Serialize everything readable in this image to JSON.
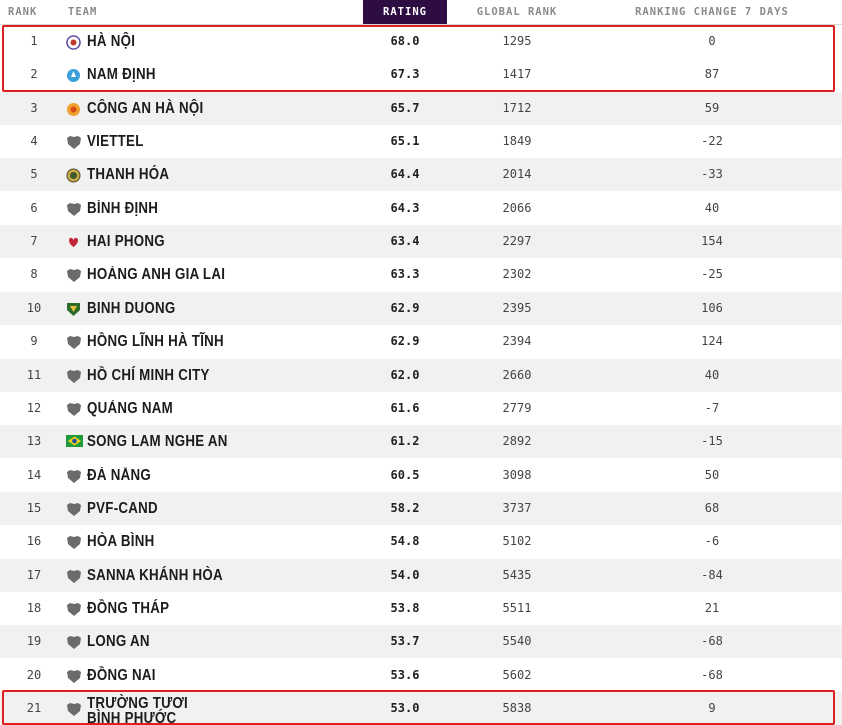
{
  "headers": {
    "rank": "RANK",
    "team": "TEAM",
    "rating": "RATING",
    "global_rank": "GLOBAL RANK",
    "change": "RANKING CHANGE 7 DAYS"
  },
  "rows": [
    {
      "rank": "1",
      "team": "HÀ NỘI",
      "rating": "68.0",
      "global": "1295",
      "change": "0",
      "icon": "hanoi-crest-icon"
    },
    {
      "rank": "2",
      "team": "NAM ĐỊNH",
      "rating": "67.3",
      "global": "1417",
      "change": "87",
      "icon": "namdinh-crest-icon"
    },
    {
      "rank": "3",
      "team": "CÔNG AN HÀ NỘI",
      "rating": "65.7",
      "global": "1712",
      "change": "59",
      "icon": "conganhanoi-crest-icon"
    },
    {
      "rank": "4",
      "team": "VIETTEL",
      "rating": "65.1",
      "global": "1849",
      "change": "-22",
      "icon": "shield-placeholder-icon"
    },
    {
      "rank": "5",
      "team": "THANH HÓA",
      "rating": "64.4",
      "global": "2014",
      "change": "-33",
      "icon": "thanhhoa-crest-icon"
    },
    {
      "rank": "6",
      "team": "BÌNH ĐỊNH",
      "rating": "64.3",
      "global": "2066",
      "change": "40",
      "icon": "shield-placeholder-icon"
    },
    {
      "rank": "7",
      "team": "HAI PHONG",
      "rating": "63.4",
      "global": "2297",
      "change": "154",
      "icon": "haiphong-crest-icon"
    },
    {
      "rank": "8",
      "team": "HOÀNG ANH GIA LAI",
      "rating": "63.3",
      "global": "2302",
      "change": "-25",
      "icon": "shield-placeholder-icon"
    },
    {
      "rank": "10",
      "team": "BINH DUONG",
      "rating": "62.9",
      "global": "2395",
      "change": "106",
      "icon": "binhduong-crest-icon"
    },
    {
      "rank": "9",
      "team": "HỒNG LĨNH HÀ TĨNH",
      "rating": "62.9",
      "global": "2394",
      "change": "124",
      "icon": "shield-placeholder-icon"
    },
    {
      "rank": "11",
      "team": "HỒ CHÍ MINH CITY",
      "rating": "62.0",
      "global": "2660",
      "change": "40",
      "icon": "shield-placeholder-icon"
    },
    {
      "rank": "12",
      "team": "QUẢNG NAM",
      "rating": "61.6",
      "global": "2779",
      "change": "-7",
      "icon": "shield-placeholder-icon"
    },
    {
      "rank": "13",
      "team": "SONG LAM NGHE AN",
      "rating": "61.2",
      "global": "2892",
      "change": "-15",
      "icon": "songlam-crest-icon"
    },
    {
      "rank": "14",
      "team": "ĐÀ NẴNG",
      "rating": "60.5",
      "global": "3098",
      "change": "50",
      "icon": "shield-placeholder-icon"
    },
    {
      "rank": "15",
      "team": "PVF-CAND",
      "rating": "58.2",
      "global": "3737",
      "change": "68",
      "icon": "shield-placeholder-icon"
    },
    {
      "rank": "16",
      "team": "HÒA BÌNH",
      "rating": "54.8",
      "global": "5102",
      "change": "-6",
      "icon": "shield-placeholder-icon"
    },
    {
      "rank": "17",
      "team": "SANNA KHÁNH HÒA",
      "rating": "54.0",
      "global": "5435",
      "change": "-84",
      "icon": "shield-placeholder-icon"
    },
    {
      "rank": "18",
      "team": "ĐỒNG THÁP",
      "rating": "53.8",
      "global": "5511",
      "change": "21",
      "icon": "shield-placeholder-icon"
    },
    {
      "rank": "19",
      "team": "LONG AN",
      "rating": "53.7",
      "global": "5540",
      "change": "-68",
      "icon": "shield-placeholder-icon"
    },
    {
      "rank": "20",
      "team": "ĐỒNG NAI",
      "rating": "53.6",
      "global": "5602",
      "change": "-68",
      "icon": "shield-placeholder-icon"
    },
    {
      "rank": "21",
      "team": "TRƯỜNG TƯƠI BÌNH PHƯỚC",
      "rating": "53.0",
      "global": "5838",
      "change": "9",
      "icon": "shield-placeholder-icon"
    }
  ],
  "colors": {
    "rating_header_bg": "#2d0d42",
    "highlight_border": "#e02020",
    "alt_row_bg": "#f1f1f1"
  }
}
